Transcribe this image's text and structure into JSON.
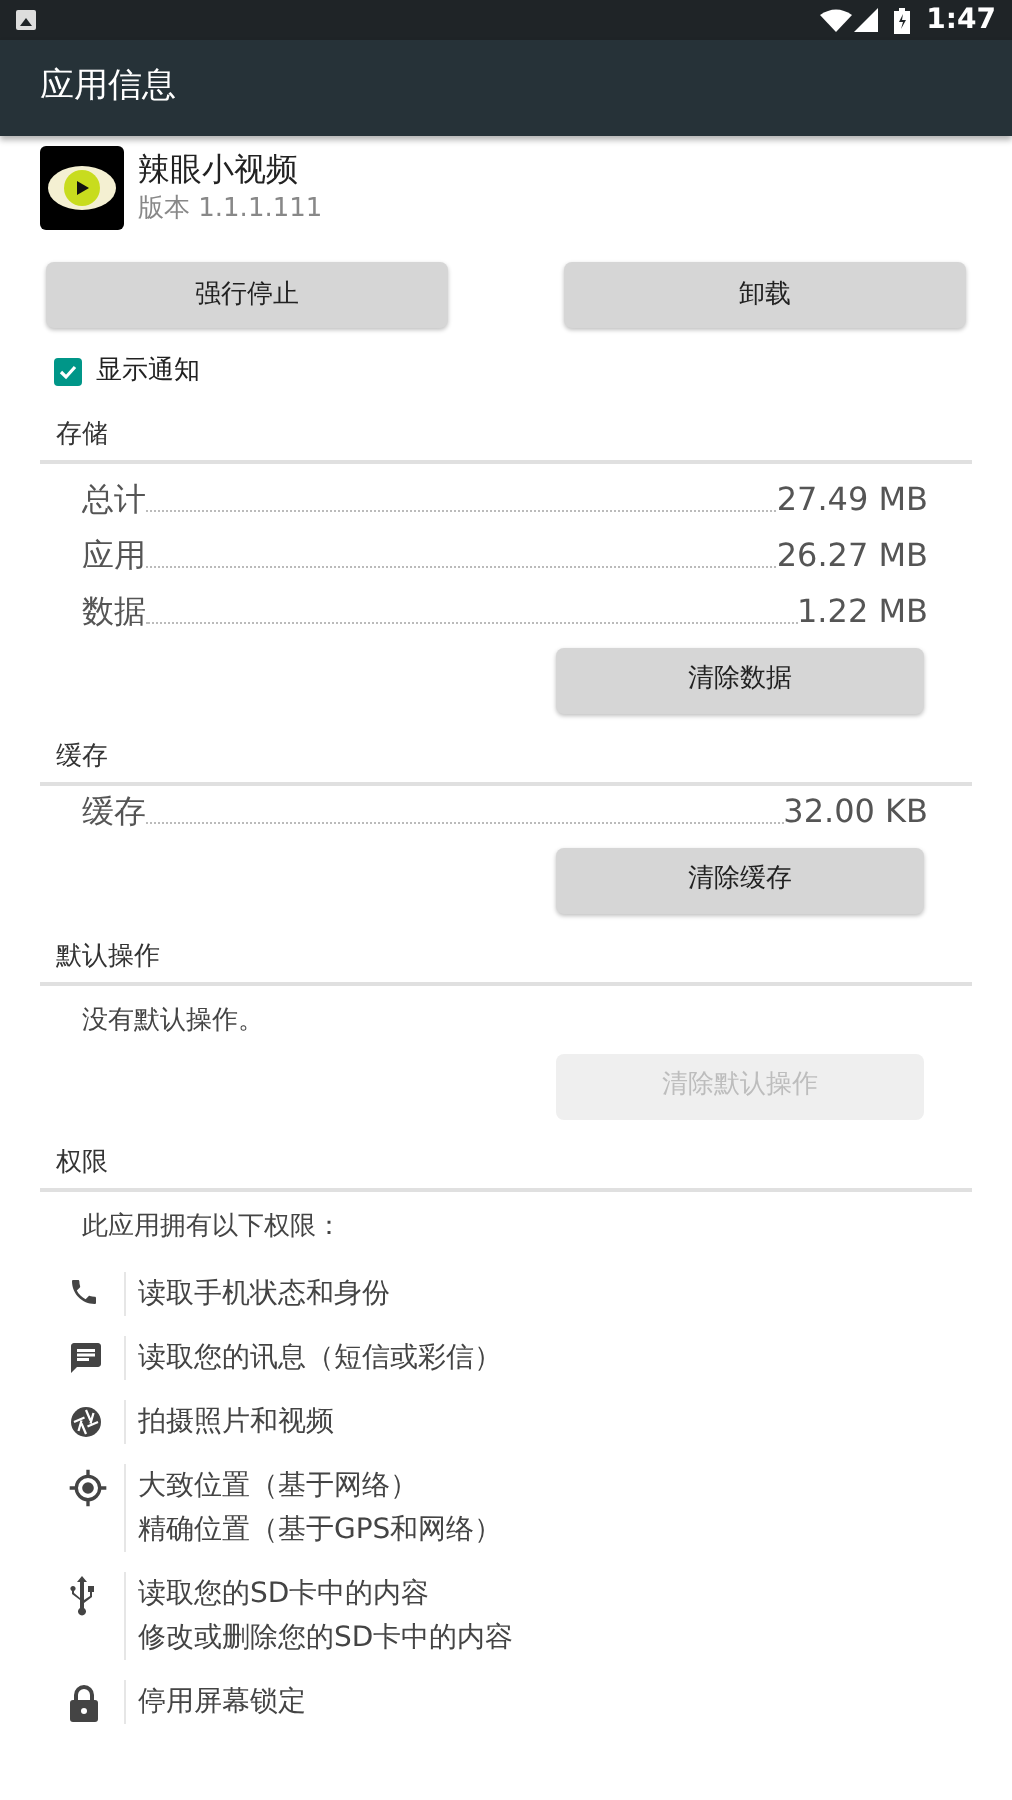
{
  "status_bar": {
    "time": "1:47"
  },
  "toolbar": {
    "title": "应用信息"
  },
  "app": {
    "name": "辣眼小视频",
    "version": "版本 1.1.1.111"
  },
  "actions": [
    {
      "label": "强行停止",
      "disabled": false
    },
    {
      "label": "卸载",
      "disabled": false
    }
  ],
  "notifications": {
    "label": "显示通知",
    "checked": true
  },
  "storage": {
    "title": "存储",
    "rows": [
      {
        "label": "总计",
        "value": "27.49 MB"
      },
      {
        "label": "应用",
        "value": "26.27 MB"
      },
      {
        "label": "数据",
        "value": "1.22 MB"
      }
    ],
    "button": {
      "label": "清除数据",
      "disabled": false
    }
  },
  "cache": {
    "title": "缓存",
    "rows": [
      {
        "label": "缓存",
        "value": "32.00 KB"
      }
    ],
    "button": {
      "label": "清除缓存",
      "disabled": false
    }
  },
  "defaults": {
    "title": "默认操作",
    "text": "没有默认操作。",
    "button": {
      "label": "清除默认操作",
      "disabled": true
    }
  },
  "permissions": {
    "title": "权限",
    "intro": "此应用拥有以下权限：",
    "items": [
      {
        "kind": "phone",
        "lines": [
          "读取手机状态和身份"
        ]
      },
      {
        "kind": "message",
        "lines": [
          "读取您的讯息（短信或彩信）"
        ]
      },
      {
        "kind": "camera",
        "lines": [
          "拍摄照片和视频"
        ]
      },
      {
        "kind": "location",
        "lines": [
          "大致位置（基于网络）",
          "精确位置（基于GPS和网络）"
        ]
      },
      {
        "kind": "usb",
        "lines": [
          "读取您的SD卡中的内容",
          "修改或删除您的SD卡中的内容"
        ]
      },
      {
        "kind": "lock",
        "lines": [
          "停用屏幕锁定"
        ]
      }
    ]
  }
}
